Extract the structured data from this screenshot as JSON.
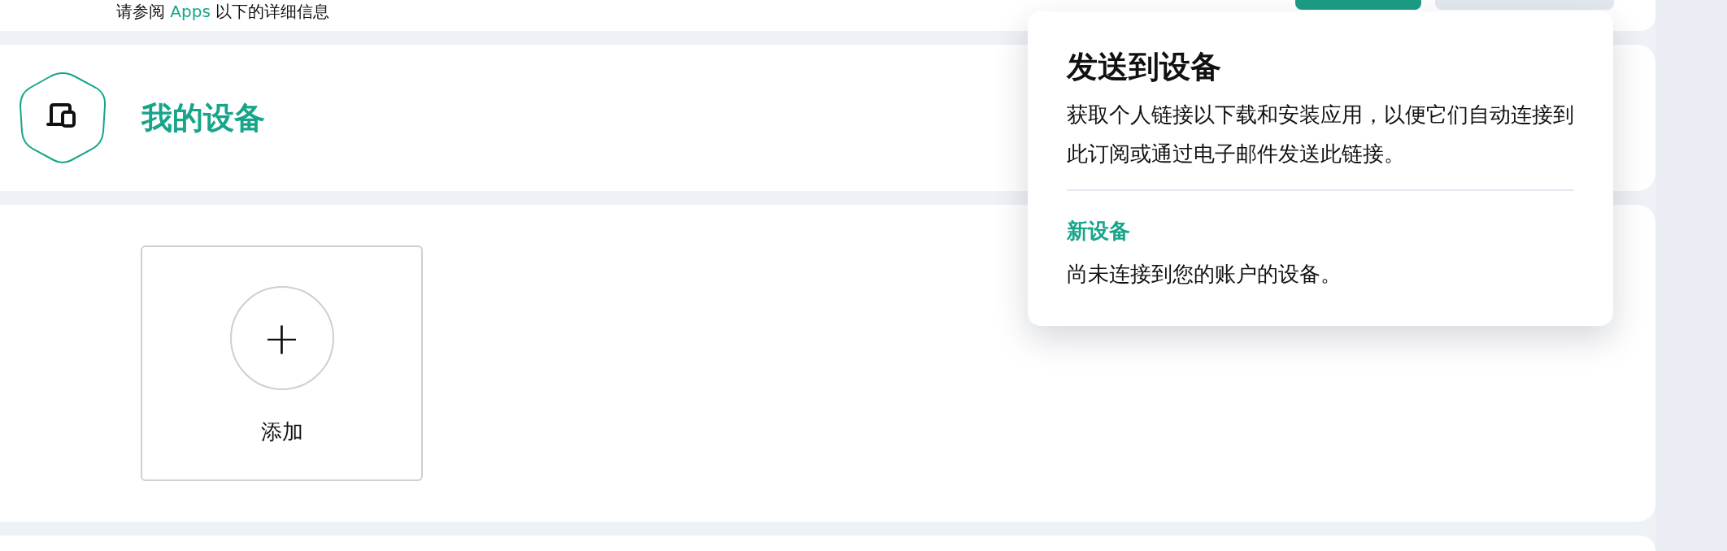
{
  "notice": {
    "before": "请参阅",
    "link": "Apps",
    "after": "以下的详细信息"
  },
  "header_buttons": [
    {
      "kind": "primary"
    },
    {
      "kind": "secondary"
    }
  ],
  "section": {
    "title": "我的设备"
  },
  "add_tile": {
    "icon": "+",
    "label": "添加"
  },
  "popover": {
    "title": "发送到设备",
    "description": "获取个人链接以下载和安装应用，以便它们自动连接到此订阅或通过电子邮件发送此链接。",
    "items": [
      {
        "title": "新设备",
        "description": "尚未连接到您的账户的设备。"
      }
    ]
  }
}
